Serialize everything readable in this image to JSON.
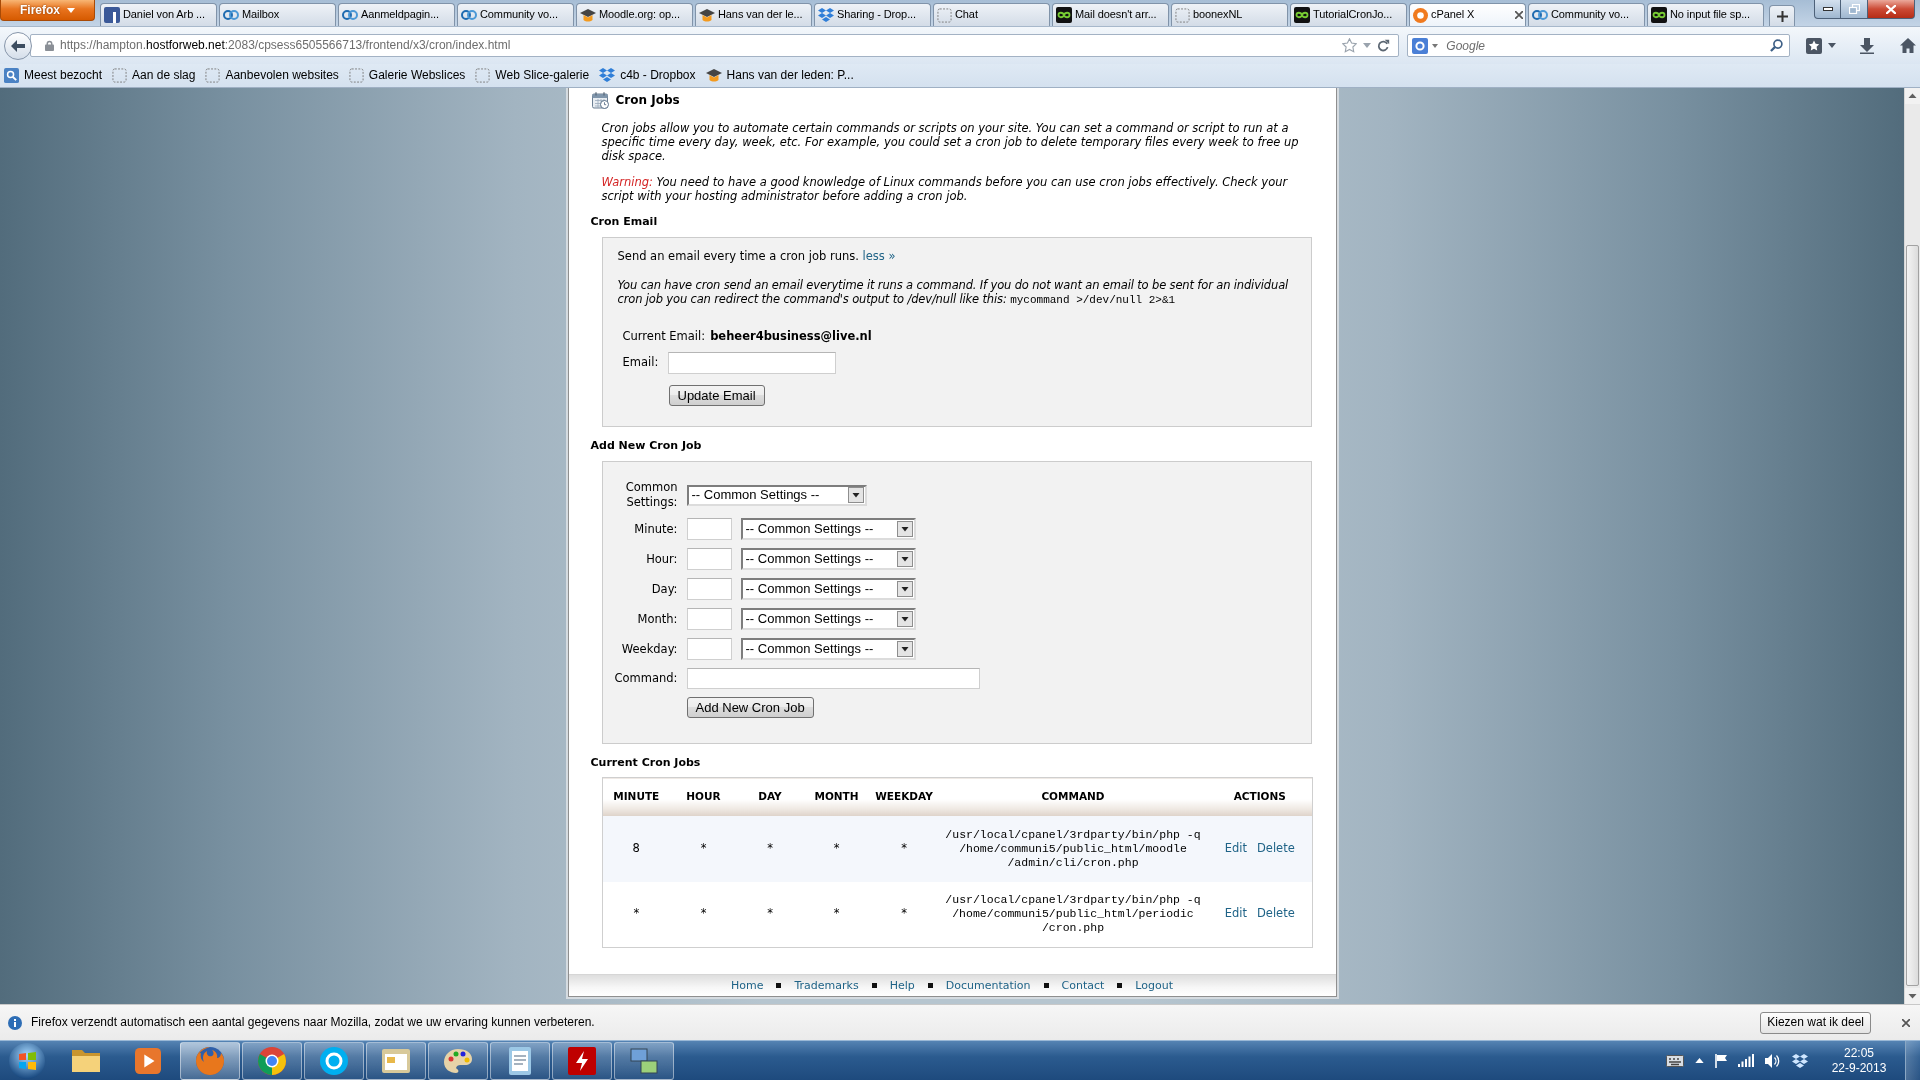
{
  "browser": {
    "app_menu": "Firefox",
    "tabs": [
      {
        "kind": "fb",
        "title": "Daniel von Arb ...",
        "selected": false
      },
      {
        "kind": "cb",
        "title": "Mailbox",
        "selected": false
      },
      {
        "kind": "cb",
        "title": "Aanmeldpagin...",
        "selected": false
      },
      {
        "kind": "cb",
        "title": "Community vo...",
        "selected": false
      },
      {
        "kind": "hat",
        "title": "Moodle.org: op...",
        "selected": false
      },
      {
        "kind": "hat",
        "title": "Hans van der le...",
        "selected": false
      },
      {
        "kind": "box",
        "title": "Sharing - Drop...",
        "selected": false
      },
      {
        "kind": "blank",
        "title": "Chat",
        "selected": false
      },
      {
        "kind": "loop",
        "title": "Mail doesn't arr...",
        "selected": false
      },
      {
        "kind": "blank",
        "title": "boonexNL",
        "selected": false
      },
      {
        "kind": "loop",
        "title": "TutorialCronJo...",
        "selected": false
      },
      {
        "kind": "cp",
        "title": "cPanel X",
        "selected": true
      },
      {
        "kind": "cb",
        "title": "Community vo...",
        "selected": false
      },
      {
        "kind": "loop",
        "title": "No input file sp...",
        "selected": false
      }
    ],
    "address": {
      "scheme_host": "https://hampton.",
      "domain": "hostforweb.net",
      "path": ":2083/cpsess6505566713/frontend/x3/cron/index.html"
    },
    "search": {
      "placeholder": "Google"
    },
    "bookmarks": [
      {
        "kind": "smart",
        "label": "Meest bezocht"
      },
      {
        "kind": "blank",
        "label": "Aan de slag"
      },
      {
        "kind": "blank",
        "label": "Aanbevolen websites"
      },
      {
        "kind": "blank",
        "label": "Galerie Webslices"
      },
      {
        "kind": "blank",
        "label": "Web Slice-galerie"
      },
      {
        "kind": "box",
        "label": "c4b - Dropbox"
      },
      {
        "kind": "hat",
        "label": "Hans van der leden: P..."
      }
    ]
  },
  "page": {
    "title": "Cron Jobs",
    "intro": "Cron jobs allow you to automate certain commands or scripts on your site. You can set a command or script to run at a specific time every day, week, etc. For example, you could set a cron job to delete temporary files every week to free up disk space.",
    "warning": {
      "label": "Warning:",
      "text": "You need to have a good knowledge of Linux commands before you can use cron jobs effectively. Check your script with your hosting administrator before adding a cron job."
    },
    "cron_email": {
      "heading": "Cron Email",
      "summary": "Send an email every time a cron job runs.",
      "toggle_link": "less »",
      "note": "You can have cron send an email everytime it runs a command. If you do not want an email to be sent for an individual cron job you can redirect the command's output to /dev/null like this:",
      "note_code": "mycommand >/dev/null 2>&1",
      "current_label": "Current Email:",
      "current_value": "beheer4business@live.nl",
      "email_label": "Email:",
      "button": "Update Email"
    },
    "add_job": {
      "heading": "Add New Cron Job",
      "common_settings": {
        "label": "Common Settings:",
        "value": "-- Common Settings --"
      },
      "fields": [
        {
          "label": "Minute:",
          "value": "-- Common Settings --"
        },
        {
          "label": "Hour:",
          "value": "-- Common Settings --"
        },
        {
          "label": "Day:",
          "value": "-- Common Settings --"
        },
        {
          "label": "Month:",
          "value": "-- Common Settings --"
        },
        {
          "label": "Weekday:",
          "value": "-- Common Settings --"
        }
      ],
      "command_label": "Command:",
      "button": "Add New Cron Job"
    },
    "current_jobs": {
      "heading": "Current Cron Jobs",
      "columns": [
        "MINUTE",
        "HOUR",
        "DAY",
        "MONTH",
        "WEEKDAY",
        "COMMAND",
        "ACTIONS"
      ],
      "rows": [
        {
          "minute": "8",
          "hour": "*",
          "day": "*",
          "month": "*",
          "weekday": "*",
          "command": [
            "/usr/local/cpanel/3rdparty/bin/php -q",
            "/home/communi5/public_html/moodle",
            "/admin/cli/cron.php"
          ],
          "actions": [
            "Edit",
            "Delete"
          ]
        },
        {
          "minute": "*",
          "hour": "*",
          "day": "*",
          "month": "*",
          "weekday": "*",
          "command": [
            "/usr/local/cpanel/3rdparty/bin/php -q",
            "/home/communi5/public_html/periodic",
            "/cron.php"
          ],
          "actions": [
            "Edit",
            "Delete"
          ]
        }
      ]
    },
    "footer_links": [
      "Home",
      "Trademarks",
      "Help",
      "Documentation",
      "Contact",
      "Logout"
    ]
  },
  "notification": {
    "text": "Firefox verzendt automatisch een aantal gegevens naar Mozilla, zodat we uw ervaring kunnen verbeteren.",
    "button": "Kiezen wat ik deel"
  },
  "taskbar": {
    "apps": [
      {
        "kind": "explorer",
        "running": false,
        "selected": false
      },
      {
        "kind": "media",
        "running": false,
        "selected": false
      },
      {
        "kind": "firefox",
        "running": true,
        "selected": true
      },
      {
        "kind": "chrome",
        "running": true,
        "selected": false
      },
      {
        "kind": "skype",
        "running": true,
        "selected": false
      },
      {
        "kind": "folders",
        "running": true,
        "selected": false
      },
      {
        "kind": "paint",
        "running": true,
        "selected": false
      },
      {
        "kind": "notepad",
        "running": true,
        "selected": false
      },
      {
        "kind": "filezilla",
        "running": true,
        "selected": false
      },
      {
        "kind": "network",
        "running": true,
        "selected": false
      }
    ],
    "time": "22:05",
    "date": "22-9-2013"
  }
}
